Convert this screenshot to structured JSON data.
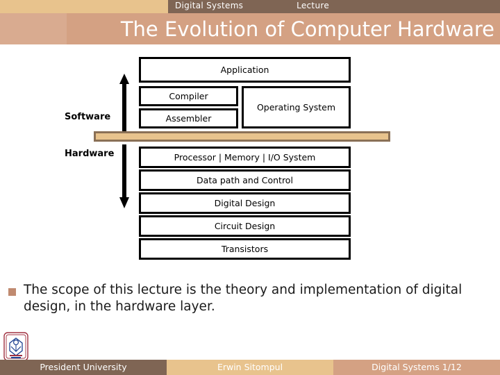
{
  "header": {
    "lecture_label": "Lecture",
    "course_label": "Digital Systems",
    "title": "The Evolution of Computer Hardware",
    "strip_bg": "#7f6554",
    "strip_left_bg": "#e8c38d",
    "title_bg": "#d4a183"
  },
  "diagram": {
    "side_labels": {
      "software": "Software",
      "hardware": "Hardware"
    },
    "software_layers": {
      "application": "Application",
      "compiler": "Compiler",
      "assembler": "Assembler",
      "operating_system": "Operating System"
    },
    "hardware_layers": [
      "Processor  |  Memory  |  I/O System",
      "Data path and Control",
      "Digital Design",
      "Circuit Design",
      "Transistors"
    ],
    "divider_fill": "#e8c38d",
    "divider_border": "#8a7056",
    "arrow_up_name": "software-up-arrow",
    "arrow_down_name": "hardware-down-arrow"
  },
  "body": {
    "bullet": "The scope of this lecture is the theory and implementation of digital design, in the hardware layer.",
    "bullet_color": "#c08a70"
  },
  "footer": {
    "university": "President University",
    "author": "Erwin Sitompul",
    "course_page": "Digital Systems 1/12",
    "logo_alt": "president-university-crest"
  }
}
